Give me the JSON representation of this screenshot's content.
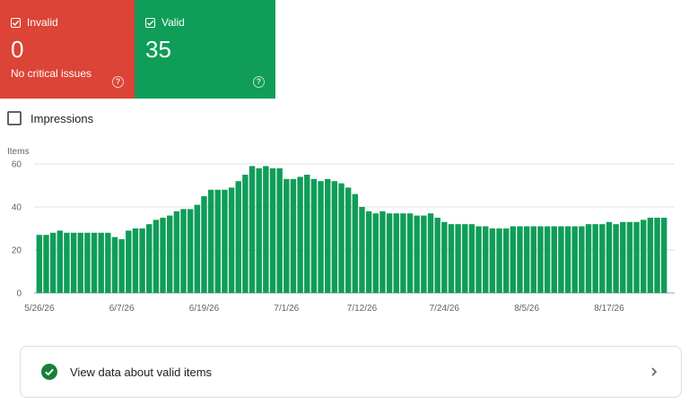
{
  "cards": {
    "invalid": {
      "label": "Invalid",
      "value": "0",
      "sub": "No critical issues",
      "color": "#db4437"
    },
    "valid": {
      "label": "Valid",
      "value": "35",
      "color": "#0f9d58"
    }
  },
  "impressions": {
    "label": "Impressions",
    "checked": false
  },
  "chart_data": {
    "type": "bar",
    "ylabel": "Items",
    "ylim": [
      0,
      60
    ],
    "yticks": [
      0,
      20,
      40,
      60
    ],
    "xtick_labels": [
      "5/26/26",
      "6/7/26",
      "6/19/26",
      "7/1/26",
      "7/12/26",
      "7/24/26",
      "8/5/26",
      "8/17/26"
    ],
    "bar_color": "#0f9d58",
    "values": [
      27,
      27,
      28,
      29,
      28,
      28,
      28,
      28,
      28,
      28,
      28,
      26,
      25,
      29,
      30,
      30,
      32,
      34,
      35,
      36,
      38,
      39,
      39,
      41,
      45,
      48,
      48,
      48,
      49,
      52,
      55,
      59,
      58,
      59,
      58,
      58,
      53,
      53,
      54,
      55,
      53,
      52,
      53,
      52,
      51,
      49,
      46,
      40,
      38,
      37,
      38,
      37,
      37,
      37,
      37,
      36,
      36,
      37,
      35,
      33,
      32,
      32,
      32,
      32,
      31,
      31,
      30,
      30,
      30,
      31,
      31,
      31,
      31,
      31,
      31,
      31,
      31,
      31,
      31,
      31,
      32,
      32,
      32,
      33,
      32,
      33,
      33,
      33,
      34,
      35,
      35,
      35
    ],
    "grid": true
  },
  "footer": {
    "label": "View data about valid items"
  },
  "colors": {
    "accent": "#0f9d58",
    "grid": "#e0e0e0",
    "axis_text": "#5f6368"
  },
  "icons": {
    "checkbox": "checkbox-checked-icon",
    "help": "help-circle-icon",
    "ok": "check-circle-icon",
    "chevron": "chevron-right-icon"
  }
}
